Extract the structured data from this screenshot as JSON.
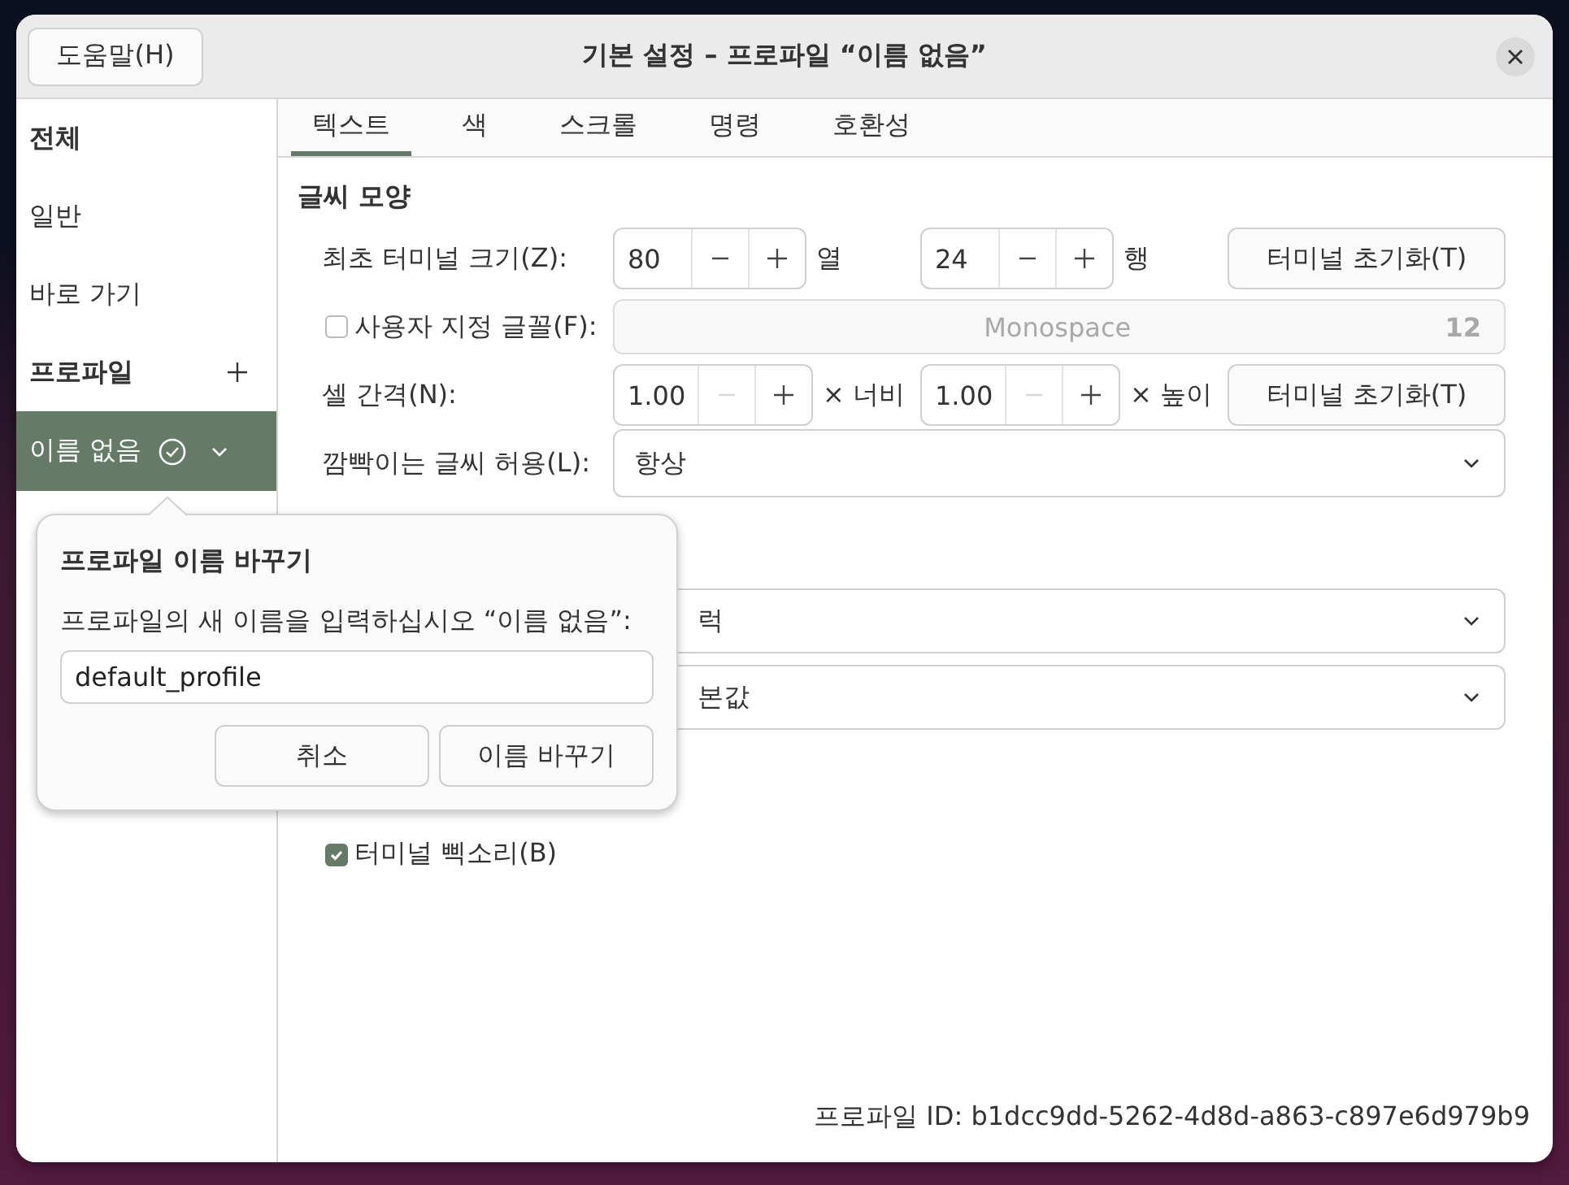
{
  "window": {
    "title": "기본 설정 – 프로파일 “이름 없음”",
    "help_button": "도움말(H)"
  },
  "sidebar": {
    "items": [
      {
        "label": "전체",
        "kind": "header",
        "selected": false
      },
      {
        "label": "일반",
        "kind": "item",
        "selected": false
      },
      {
        "label": "바로 가기",
        "kind": "item",
        "selected": false
      },
      {
        "label": "프로파일",
        "kind": "section",
        "selected": false
      },
      {
        "label": "이름 없음",
        "kind": "profile",
        "selected": true
      }
    ]
  },
  "tabs": [
    {
      "label": "텍스트",
      "selected": true
    },
    {
      "label": "색",
      "selected": false
    },
    {
      "label": "스크롤",
      "selected": false
    },
    {
      "label": "명령",
      "selected": false
    },
    {
      "label": "호환성",
      "selected": false
    }
  ],
  "text_section": {
    "title": "글씨 모양",
    "rows": [
      {
        "kind": "size",
        "label": "최초 터미널 크기(Z):",
        "fields": [
          {
            "value": "80",
            "unit": "열",
            "minus_disabled": false
          },
          {
            "value": "24",
            "unit": "행",
            "minus_disabled": false
          }
        ],
        "button": "터미널 초기화(T)"
      },
      {
        "kind": "font",
        "label": "사용자 지정 글꼴(F):",
        "checked": false,
        "font": "Monospace",
        "size": "12",
        "disabled": true
      },
      {
        "kind": "spacing",
        "label": "셀 간격(N):",
        "fields": [
          {
            "value": "1.00",
            "unit": "× 너비",
            "minus_disabled": true
          },
          {
            "value": "1.00",
            "unit": "× 높이",
            "minus_disabled": true
          }
        ],
        "button": "터미널 초기화(T)"
      },
      {
        "kind": "dropdown",
        "label": "깜빡이는 글씨 허용(L):",
        "value": "항상"
      }
    ]
  },
  "hidden_section": {
    "rows": [
      {
        "kind": "dropdown",
        "value": "럭"
      },
      {
        "kind": "dropdown",
        "value": "본값"
      }
    ]
  },
  "beep": {
    "label": "터미널 삑소리(B)",
    "checked": true
  },
  "popover": {
    "title": "프로파일 이름 바꾸기",
    "prompt": "프로파일의 새 이름을 입력하십시오 “이름 없음”:",
    "value": "default_profile",
    "buttons": [
      "취소",
      "이름 바꾸기"
    ]
  },
  "profile_id": "프로파일 ID: b1dcc9dd-5262-4d8d-a863-c897e6d979b9"
}
